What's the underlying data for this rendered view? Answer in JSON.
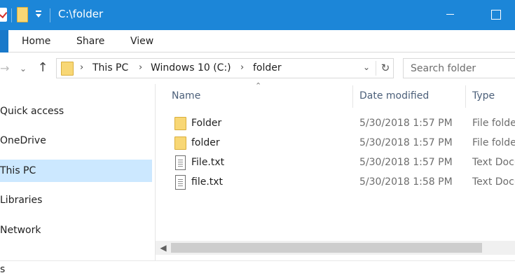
{
  "window": {
    "title": "C:\\folder"
  },
  "ribbon": {
    "tabs": [
      "Home",
      "Share",
      "View"
    ]
  },
  "address": {
    "crumbs": [
      "This PC",
      "Windows 10 (C:)",
      "folder"
    ]
  },
  "search": {
    "placeholder": "Search folder"
  },
  "nav": {
    "items": [
      "Quick access",
      "OneDrive",
      "This PC",
      "Libraries",
      "Network"
    ],
    "selected": "This PC"
  },
  "columns": {
    "name": "Name",
    "date": "Date modified",
    "type": "Type"
  },
  "files": [
    {
      "icon": "folder-icon",
      "name": "Folder",
      "date": "5/30/2018 1:57 PM",
      "type": "File folder"
    },
    {
      "icon": "folder-icon",
      "name": "folder",
      "date": "5/30/2018 1:57 PM",
      "type": "File folder"
    },
    {
      "icon": "text-file-icon",
      "name": "File.txt",
      "date": "5/30/2018 1:57 PM",
      "type": "Text Document"
    },
    {
      "icon": "text-file-icon",
      "name": "file.txt",
      "date": "5/30/2018 1:58 PM",
      "type": "Text Document"
    }
  ],
  "status": {
    "text": "s"
  },
  "colors": {
    "titlebar": "#1c86d8",
    "selection": "#cce8ff",
    "folder": "#f8d775"
  }
}
